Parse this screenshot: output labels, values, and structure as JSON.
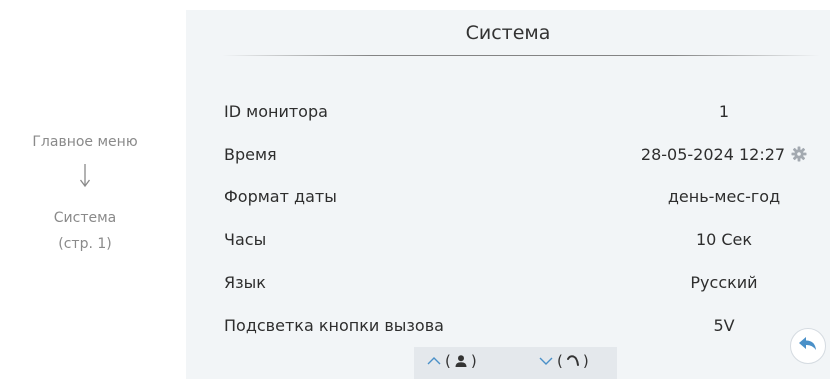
{
  "sidebar": {
    "main_menu": "Главное меню",
    "system": "Система",
    "page": "(стр. 1)"
  },
  "screen": {
    "title": "Система",
    "rows": [
      {
        "label": "ID монитора",
        "value": "1"
      },
      {
        "label": "Время",
        "value": "28-05-2024 12:27"
      },
      {
        "label": "Формат даты",
        "value": "день-мес-год"
      },
      {
        "label": "Часы",
        "value": "10 Сек"
      },
      {
        "label": "Язык",
        "value": "Русский"
      },
      {
        "label": "Подсветка кнопки вызова",
        "value": "5V"
      }
    ],
    "nav": {
      "up_open": "(",
      "up_close": ")",
      "down_open": "(",
      "down_close": ")"
    }
  },
  "icons": {
    "gear": "gear-icon",
    "up": "chevron-up-icon",
    "down": "chevron-down-icon",
    "user": "user-icon",
    "handset": "handset-icon",
    "back": "back-arrow-icon"
  },
  "colors": {
    "accent": "#4a90c8",
    "screen_bg": "#f2f5f7",
    "caption": "#8a8a8a"
  }
}
